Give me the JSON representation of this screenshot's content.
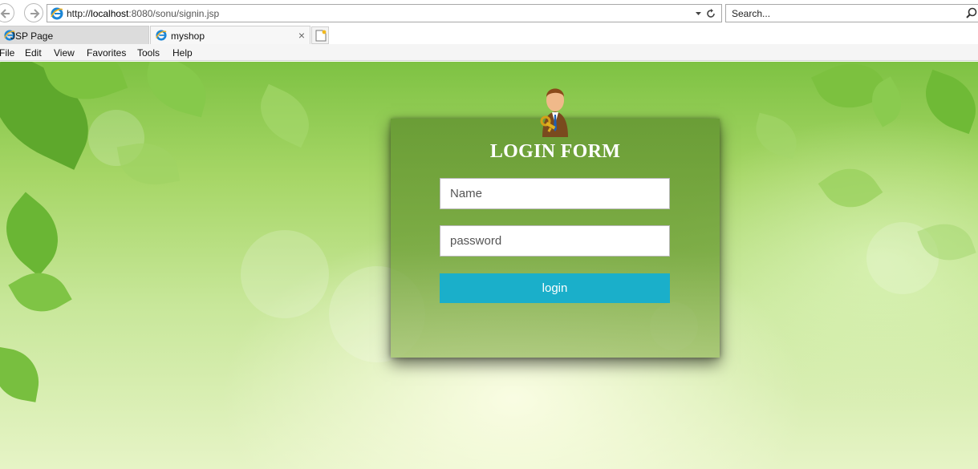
{
  "browser": {
    "address": {
      "url_scheme": "http://",
      "url_host": "localhost",
      "url_rest": ":8080/sonu/signin.jsp"
    },
    "search": {
      "placeholder": "Search..."
    },
    "tabs": [
      {
        "label": "JSP Page",
        "active": false
      },
      {
        "label": "myshop",
        "active": true,
        "close": "×"
      }
    ],
    "menu": [
      "File",
      "Edit",
      "View",
      "Favorites",
      "Tools",
      "Help"
    ]
  },
  "login": {
    "title": "LOGIN FORM",
    "name_placeholder": "Name",
    "password_placeholder": "password",
    "button_label": "login",
    "button_color": "#1aafca"
  }
}
